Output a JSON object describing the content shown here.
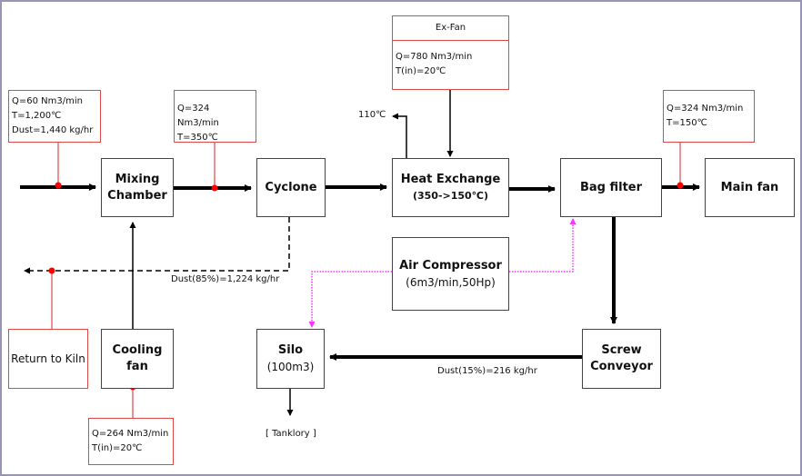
{
  "process": {
    "mixing_chamber": [
      "Mixing",
      "Chamber"
    ],
    "cyclone": "Cyclone",
    "heat_exchange": {
      "title": "Heat Exchange",
      "sub": "(350->150℃)"
    },
    "bag_filter": "Bag filter",
    "main_fan": "Main fan",
    "air_compressor": {
      "title": "Air Compressor",
      "sub": "(6m3/min,50Hp)"
    },
    "silo": {
      "title": "Silo",
      "sub": "(100m3)"
    },
    "screw_conveyor": [
      "Screw",
      "Conveyor"
    ],
    "return_to_kiln": "Return to Kiln",
    "cooling_fan": "Cooling fan"
  },
  "conditions": {
    "inlet": [
      "Q=60 Nm3/min",
      "T=1,200℃",
      "Dust=1,440 kg/hr"
    ],
    "after_mixing": [
      "Q=324 Nm3/min",
      "T=350℃"
    ],
    "ex_fan": {
      "title": "Ex-Fan",
      "lines": [
        "Q=780 Nm3/min",
        "T(in)=20℃"
      ]
    },
    "after_bag_filter": [
      "Q=324 Nm3/min",
      "T=150℃"
    ],
    "cooling_fan": [
      "Q=264 Nm3/min",
      "T(in)=20℃"
    ]
  },
  "labels": {
    "exhaust_temp": "110℃",
    "cyclone_dust": "Dust(85%)=1,224 kg/hr",
    "bag_dust": "Dust(15%)=216 kg/hr",
    "tanklory": "[ Tanklory ]"
  },
  "colors": {
    "annotation": "#e04848",
    "compressed_air": "#ff33ff",
    "flow": "#000000"
  }
}
